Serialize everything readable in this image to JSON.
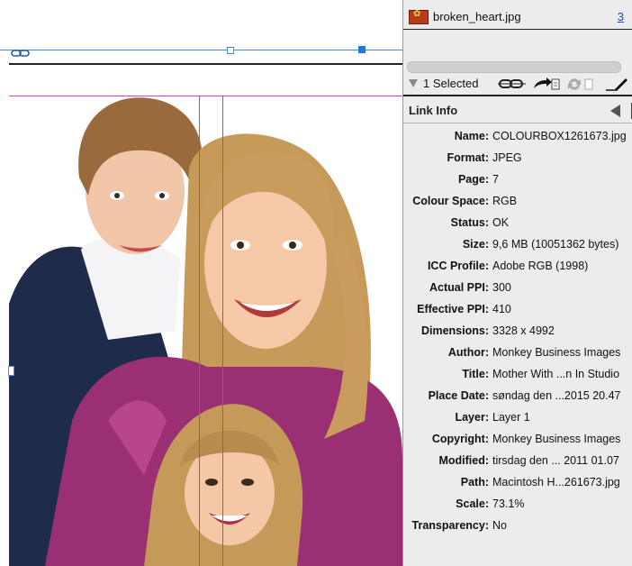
{
  "links_panel": {
    "file": {
      "name": "broken_heart.jpg",
      "count": "3",
      "thumb_icon": "image-thumbnail-icon"
    },
    "selection": {
      "text": "1 Selected",
      "toggle_icon": "disclosure-triangle-down-icon",
      "tools": [
        "relink-icon",
        "go-to-link-icon",
        "update-link-icon",
        "edit-original-icon"
      ]
    },
    "link_info": {
      "title": "Link Info",
      "collapse_icon": "triangle-left-icon",
      "rows": [
        {
          "label": "Name:",
          "value": "COLOURBOX1261673.jpg"
        },
        {
          "label": "Format:",
          "value": "JPEG"
        },
        {
          "label": "Page:",
          "value": "7"
        },
        {
          "label": "Colour Space:",
          "value": "RGB"
        },
        {
          "label": "Status:",
          "value": "OK"
        },
        {
          "label": "Size:",
          "value": "9,6 MB (10051362 bytes)"
        },
        {
          "label": "ICC Profile:",
          "value": "Adobe RGB (1998)"
        },
        {
          "label": "Actual PPI:",
          "value": "300"
        },
        {
          "label": "Effective PPI:",
          "value": "410"
        },
        {
          "label": "Dimensions:",
          "value": "3328 x 4992"
        },
        {
          "label": "Author:",
          "value": "Monkey Business Images"
        },
        {
          "label": "Title:",
          "value": "Mother With ...n In Studio"
        },
        {
          "label": "Place Date:",
          "value": "søndag den ...2015 20.47"
        },
        {
          "label": "Layer:",
          "value": "Layer 1"
        },
        {
          "label": "Copyright:",
          "value": "Monkey Business Images"
        },
        {
          "label": "Modified:",
          "value": "tirsdag den ... 2011 01.07"
        },
        {
          "label": "Path:",
          "value": "Macintosh H...261673.jpg"
        },
        {
          "label": "Scale:",
          "value": "73.1%"
        },
        {
          "label": "Transparency:",
          "value": "No"
        }
      ]
    }
  },
  "canvas": {
    "chain_icon": "chain-link-icon",
    "photo": "family-portrait-photo"
  },
  "colors": {
    "guide_magenta": "#d63fd6",
    "frame_blue": "#3a8ee6",
    "panel_bg": "#ececec"
  }
}
